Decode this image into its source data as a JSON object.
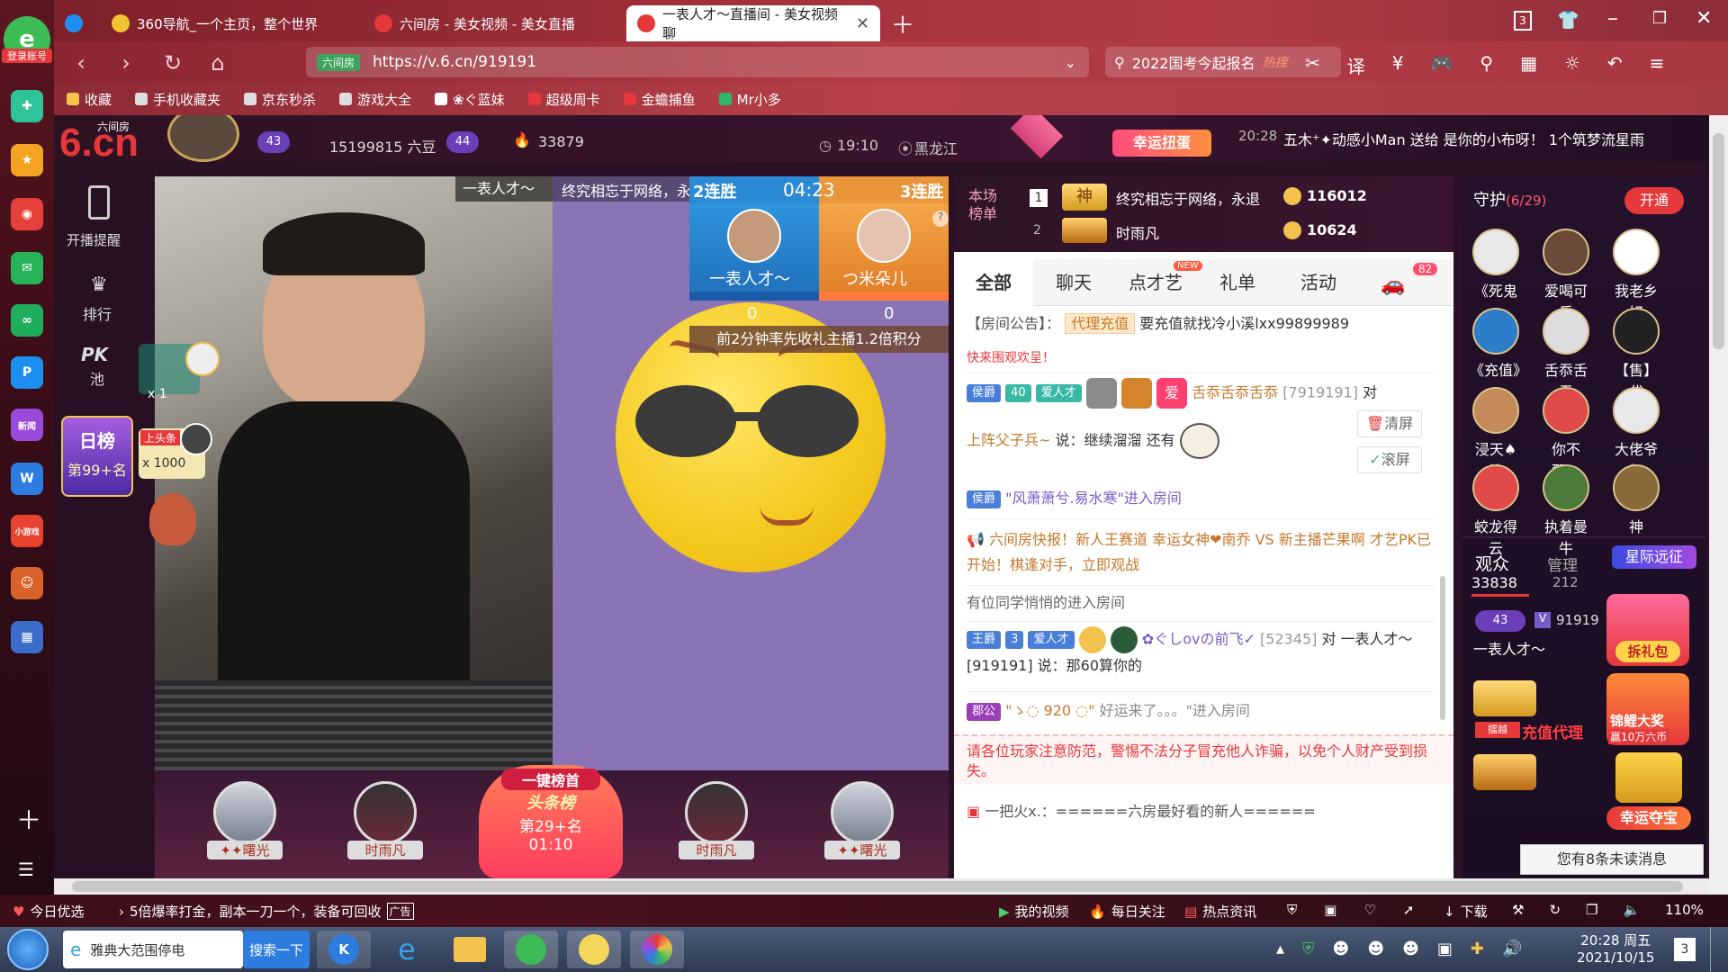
{
  "browser": {
    "login_label": "登录账号",
    "tabs": [
      {
        "label": "360导航_一个主页，整个世界"
      },
      {
        "label": "六间房 - 美女视频 - 美女直播"
      },
      {
        "label": "一表人才～直播间 - 美女视频聊"
      }
    ],
    "window_count": "3",
    "url_prefix": "六间房",
    "url": "https://v.6.cn/919191",
    "search_placeholder": "2022国考今起报名",
    "search_tag": "热搜",
    "bookmarks": [
      "收藏",
      "手机收藏夹",
      "京东秒杀",
      "游戏大全",
      "❀ぐ蓝妹",
      "超级周卡",
      "金蟾捕鱼",
      "Mr小多"
    ]
  },
  "left_sidebar": {
    "items": [
      {
        "icon": "chat-bubble-icon",
        "color": "#2fc39a"
      },
      {
        "icon": "star-icon",
        "color": "#f3a322"
      },
      {
        "icon": "weibo-icon",
        "color": "#e6403a"
      },
      {
        "icon": "mail-icon",
        "color": "#27b35a"
      },
      {
        "icon": "sync-icon",
        "color": "#1fae5b"
      },
      {
        "icon": "p-icon",
        "color": "#1c8ff0"
      },
      {
        "icon": "news-icon",
        "color": "#9a4adb",
        "label": "新闻"
      },
      {
        "icon": "doc-icon",
        "color": "#2d7de0"
      },
      {
        "icon": "game-icon",
        "color": "#e8432f",
        "label": "小游戏"
      },
      {
        "icon": "avatar-icon",
        "color": "#d7632b"
      },
      {
        "icon": "city-icon",
        "color": "#3b6cc9"
      }
    ]
  },
  "site": {
    "logo": "6.cn",
    "logo_sub": "六间房",
    "host_level": "43",
    "host_beans": "15199815 六豆",
    "next_level": "44",
    "fire_count": "33879",
    "time": "19:10",
    "location": "黑龙江",
    "lucky_egg_label": "幸运扭蛋",
    "broadcast": {
      "time": "20:28",
      "text": "五木⁺✦动感小Man 送给 是你的小布呀！ 1个筑梦流星雨"
    }
  },
  "video_left": {
    "start_label": "开播提醒",
    "rank_label": "排行",
    "pk_label": "PK",
    "pk_sub": "池",
    "daily_rank_label": "日榜",
    "daily_rank_value": "第99+名",
    "dragon_count": "x 1",
    "headline_count": "x 1000",
    "headline_tag": "上头条"
  },
  "pk": {
    "left_name": "一表人才～",
    "right_name": "つ米朵儿",
    "left_streak": "2连胜",
    "right_streak": "3连胜",
    "timer": "04:23",
    "left_score": "0",
    "right_score": "0",
    "tip": "前2分钟率先收礼主播1.2倍积分",
    "host_label": "一表人才～",
    "marquee": "终究相忘于网络，永"
  },
  "bottom_strip": {
    "seats": [
      {
        "name": "✦✦曙光"
      },
      {
        "name": "时雨凡"
      },
      {
        "name": "时雨凡"
      },
      {
        "name": "✦✦曙光"
      }
    ],
    "center_title": "一键榜首",
    "center_sub": "头条榜",
    "center_rank": "第29+名",
    "center_time": "01:10"
  },
  "rank_board": {
    "title": "本场榜单",
    "rows": [
      {
        "rank": "1",
        "name": "终究相忘于网络，永退",
        "score": "116012",
        "medal": "神"
      },
      {
        "rank": "2",
        "name": "时雨凡",
        "score": "10624",
        "medal": ""
      }
    ]
  },
  "chat_tabs": [
    {
      "label": "全部",
      "active": true
    },
    {
      "label": "聊天"
    },
    {
      "label": "点才艺",
      "badge": "NEW"
    },
    {
      "label": "礼单"
    },
    {
      "label": "活动"
    },
    {
      "label": "",
      "count": "82"
    }
  ],
  "chat": {
    "notice_prefix": "【房间公告】：",
    "notice_tag": "代理充值",
    "notice_text": "要充值就找冷小溪lxx99899989",
    "welcome_fragment": "快来围观欢呈！",
    "messages": [
      {
        "badge": "侯爵",
        "level": "40",
        "tag": "爱人才",
        "user": "舌忝舌忝舌忝",
        "uid": "[7919191]",
        "suffix": "对"
      },
      {
        "user": "上阵父子兵~",
        "text": "说：继续溜溜 还有"
      },
      {
        "badge": "侯爵",
        "text": "\"风萧萧兮.易水寒\"进入房间"
      },
      {
        "text": "六间房快报！新人王赛道 幸运女神❤南乔 VS 新主播芒果啊 才艺PK已开始！棋逢对手，立即观战"
      },
      {
        "text": "有位同学悄悄的进入房间"
      },
      {
        "badge": "王爵",
        "level": "3",
        "tag": "爱人才",
        "user": "✿ぐしovの前飞✓",
        "uid": "[52345]",
        "text": "对 一表人才～[919191] 说：那60算你的"
      },
      {
        "badge": "郡公",
        "user": "\"ゝ◌ 920 ◌\"",
        "text": "好运来了。。。\"进入房间"
      }
    ],
    "warning": "请各位玩家注意防范，警惕不法分子冒充他人诈骗，以免个人财产受到损失。",
    "last_msg": "一把火x.：======六房最好看的新人======",
    "clear_label": "清屏",
    "scroll_label": "滚屏"
  },
  "guard": {
    "title": "守护",
    "count": "(6/29)",
    "open_label": "开通",
    "members": [
      {
        "name": "《死鬼"
      },
      {
        "name": "爱喝可乐"
      },
      {
        "name": "我老乡好"
      },
      {
        "name": "《充值》"
      },
      {
        "name": "舌忝舌忝"
      },
      {
        "name": "【售】代"
      },
      {
        "name": "浸天♠神"
      },
      {
        "name": "你不配？"
      },
      {
        "name": "大佬爷驾"
      },
      {
        "name": "蛟龙得云"
      },
      {
        "name": "执着曼牛"
      },
      {
        "name": "神"
      }
    ],
    "star_expedition": "星际远征",
    "audience_label": "观众",
    "audience_count": "33838",
    "manage_label": "管理",
    "manage_count": "212",
    "viewer_id": "91919",
    "viewer_name": "一表人才～",
    "gift_pack": "拆礼包",
    "koi": "锦鲤大奖",
    "koi_sub": "赢10万六币",
    "lucky_treasure": "幸运夺宝",
    "recharge_agent": "充值代理",
    "unread": "您有8条未读消息"
  },
  "statusbar": {
    "left_items": [
      "今日优选",
      "5倍爆率打金，副本一刀一个，装备可回收",
      "广告"
    ],
    "right_items": [
      "我的视频",
      "每日关注",
      "热点资讯",
      "下载"
    ],
    "zoom": "110%"
  },
  "taskbar": {
    "search_text": "雅典大范围停电",
    "search_button": "搜索一下",
    "time": "20:28 周五",
    "date": "2021/10/15",
    "notify_count": "3"
  },
  "colors": {
    "brand_red": "#e5383b",
    "gold": "#f2c14e",
    "pk_blue": "#2a8ad6",
    "pk_orange": "#e9963a",
    "chat_orange": "#c5772a"
  }
}
